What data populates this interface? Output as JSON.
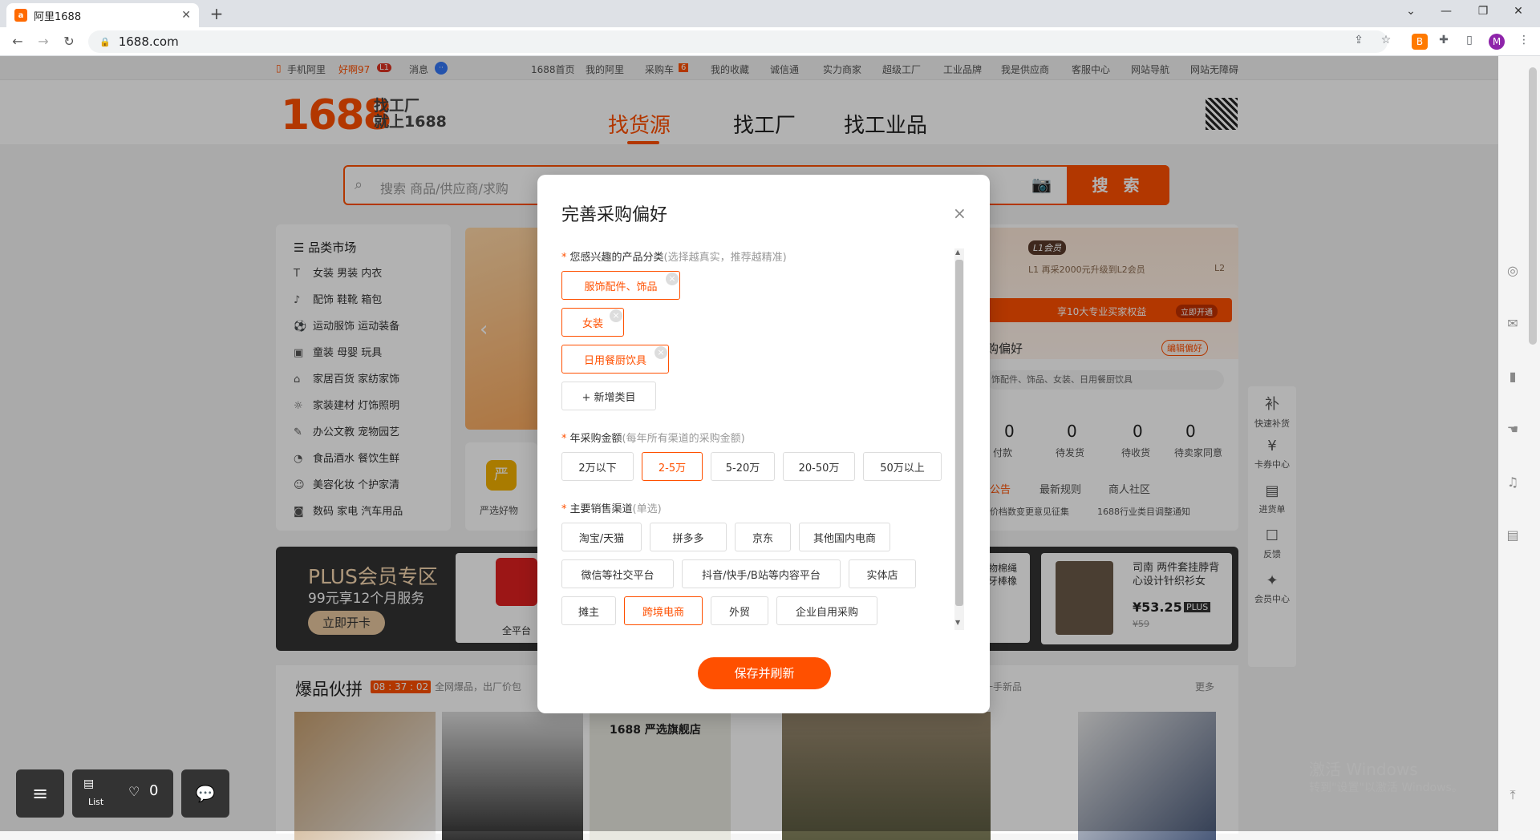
{
  "browser": {
    "tab_title": "阿里1688",
    "tab_close": "✕",
    "new_tab": "+",
    "url": "1688.com",
    "profile_initial": "M",
    "ext_badge": "B"
  },
  "topnav": {
    "mobile": "手机阿里",
    "username": "好啊97",
    "level": "L1",
    "messages": "消息",
    "links": [
      "1688首页",
      "我的阿里",
      "采购车",
      "我的收藏",
      "诚信通",
      "实力商家",
      "超级工厂",
      "工业品牌",
      "我是供应商",
      "客服中心",
      "网站导航",
      "网站无障碍"
    ],
    "cart_count": "6"
  },
  "header": {
    "logo": "1688",
    "slogan_1": "找工厂",
    "slogan_2": "就上1688",
    "tabs": [
      "找货源",
      "找工厂",
      "找工业品"
    ],
    "search_placeholder": "搜索 商品/供应商/求购",
    "search_button": "搜 索"
  },
  "categories": {
    "title": "品类市场",
    "rows": [
      {
        "icon": "T",
        "label": "女装  男装  内衣"
      },
      {
        "icon": "♪",
        "label": "配饰  鞋靴  箱包"
      },
      {
        "icon": "⚽",
        "label": "运动服饰  运动装备"
      },
      {
        "icon": "▣",
        "label": "童装  母婴  玩具"
      },
      {
        "icon": "⌂",
        "label": "家居百货  家纺家饰"
      },
      {
        "icon": "☼",
        "label": "家装建材  灯饰照明"
      },
      {
        "icon": "✎",
        "label": "办公文教  宠物园艺"
      },
      {
        "icon": "◔",
        "label": "食品酒水  餐饮生鲜"
      },
      {
        "icon": "☺",
        "label": "美容化妆  个护家清"
      },
      {
        "icon": "◙",
        "label": "数码  家电  汽车用品"
      }
    ]
  },
  "right_panel": {
    "member_badge": "L1会员",
    "upgrade_text": "L1 再采2000元升级到L2会员",
    "level_end": "L2",
    "vip_bar_text": "享10大专业买家权益",
    "vip_bar_btn": "立即开通",
    "pref_title": "购偏好",
    "pref_edit": "编辑偏好",
    "pref_value": "饰配件、饰品、女装、日用餐厨饮具",
    "order_counts": [
      "0",
      "0",
      "0",
      "0"
    ],
    "order_labels": [
      "付款",
      "待发货",
      "待收货",
      "待卖家同意"
    ],
    "news_tabs": [
      "公告",
      "最新规则",
      "商人社区"
    ],
    "news_items": [
      "价档数变更意见征集",
      "1688行业类目调整通知"
    ]
  },
  "banner": {
    "strict_label": "严选好物",
    "plus_title": "PLUS会员专区",
    "plus_sub": "99元享12个月服务",
    "plus_btn": "立即开卡",
    "platform_label": "全平台",
    "goods_name_1": "物棉绳",
    "goods_name_2": "牙棒橡",
    "goods_title": "司南 两件套挂脖背心设计针织衫女",
    "goods_price": "¥53.25",
    "plus_badge": "PLUS",
    "goods_old_price": "¥59"
  },
  "hot": {
    "title": "爆品伙拼",
    "timer": "08 : 37 : 02",
    "subtitle": "全网爆品，出厂价包",
    "right_text": "一手新品",
    "more": "更多",
    "shoe_brand": "1688 严选旗舰店"
  },
  "side_tools": [
    "快速补货",
    "卡券中心",
    "进货单",
    "反馈",
    "会员中心"
  ],
  "modal": {
    "title": "完善采购偏好",
    "close": "×",
    "category_label": "您感兴趣的产品分类",
    "category_hint": "(选择越真实，推荐越精准)",
    "categories": [
      "服饰配件、饰品",
      "女装",
      "日用餐厨饮具"
    ],
    "add_category": "+ 新增类目",
    "amount_label": "年采购金额",
    "amount_hint": "(每年所有渠道的采购金额)",
    "amounts": [
      "2万以下",
      "2-5万",
      "5-20万",
      "20-50万",
      "50万以上"
    ],
    "channel_label": "主要销售渠道",
    "channel_hint": "(单选)",
    "channels_row1": [
      "淘宝/天猫",
      "拼多多",
      "京东",
      "其他国内电商"
    ],
    "channels_row2": [
      "微信等社交平台",
      "抖音/快手/B站等内容平台",
      "实体店"
    ],
    "channels_row3": [
      "摊主",
      "跨境电商",
      "外贸",
      "企业自用采购"
    ],
    "save_button": "保存并刷新"
  },
  "floating": {
    "list_label": "List",
    "fav_count": "0"
  },
  "watermark": {
    "line1": "激活 Windows",
    "line2": "转到\"设置\"以激活 Windows。"
  }
}
